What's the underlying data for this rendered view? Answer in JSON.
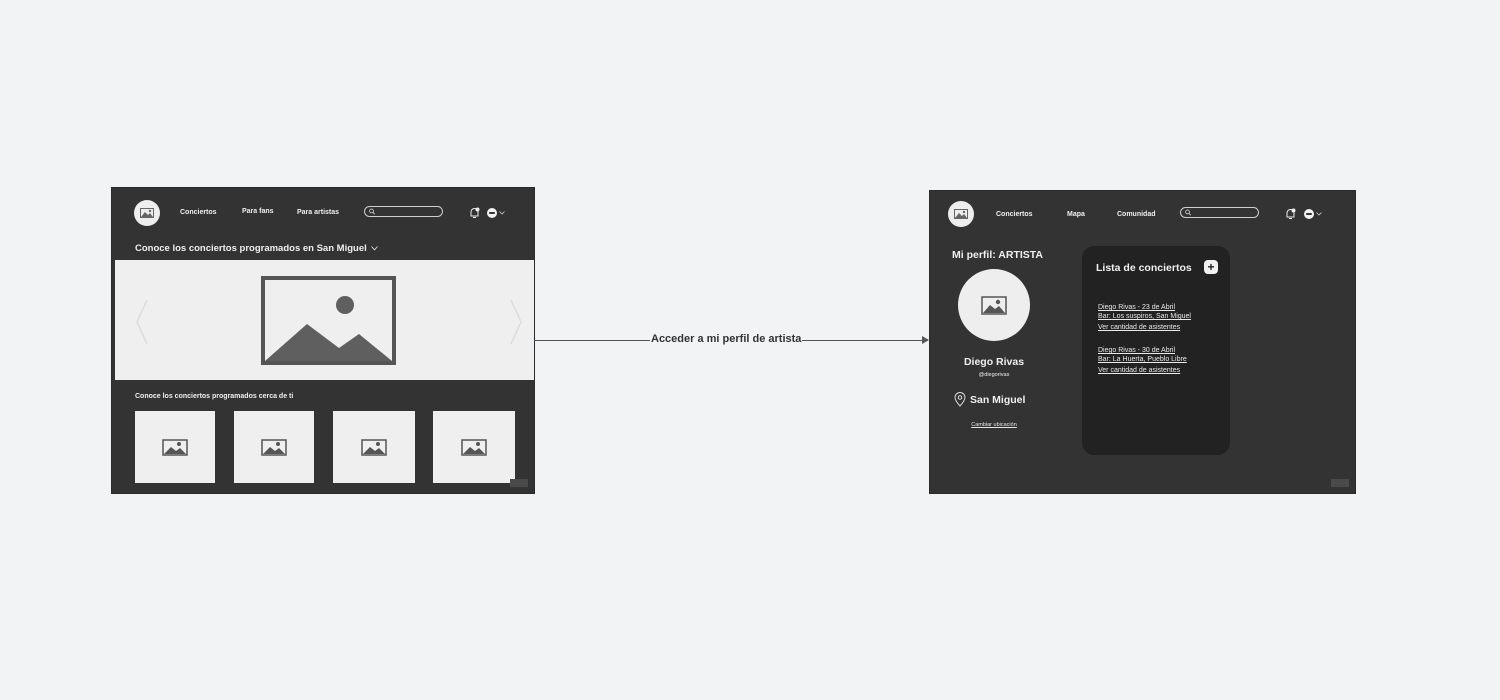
{
  "connector": {
    "label": "Acceder a mi perfil de artista"
  },
  "left_screen": {
    "nav": {
      "conciertos": "Conciertos",
      "para_fans": "Para fans",
      "para_artistas": "Para artistas"
    },
    "search": {
      "value": "",
      "placeholder": ""
    },
    "icons": {
      "logo": "image-icon",
      "bell": "bell-icon",
      "avatar": "user-avatar-icon",
      "chevron": "chevron-down-icon"
    },
    "hero_title": "Conoce los conciertos programados en San Miguel",
    "nearby_title": "Conoce los conciertos programados cerca de ti",
    "thumbnails": 4
  },
  "right_screen": {
    "nav": {
      "conciertos": "Conciertos",
      "mapa": "Mapa",
      "comunidad": "Comunidad"
    },
    "search": {
      "value": "",
      "placeholder": ""
    },
    "profile": {
      "title": "Mi perfil: ARTISTA",
      "name": "Diego Rivas",
      "handle": "@diegorivas",
      "location": "San Miguel",
      "change_location": "Cambiar ubicación"
    },
    "concert_list": {
      "title": "Lista de conciertos",
      "add_label": "+",
      "items": [
        {
          "line1": "Diego Rivas - 23 de Abril",
          "line2": "Bar: Los suspiros, San Miguel",
          "attendees": "Ver cantidad de asistentes"
        },
        {
          "line1": "Diego Rivas - 30 de Abril",
          "line2": "Bar: La Huerta, Pueblo Libre",
          "attendees": "Ver cantidad de asistentes"
        }
      ]
    }
  },
  "colors": {
    "frame_bg": "#333333",
    "canvas_bg": "#f2f3f5",
    "panel_bg": "#222222",
    "placeholder": "#efefef"
  }
}
